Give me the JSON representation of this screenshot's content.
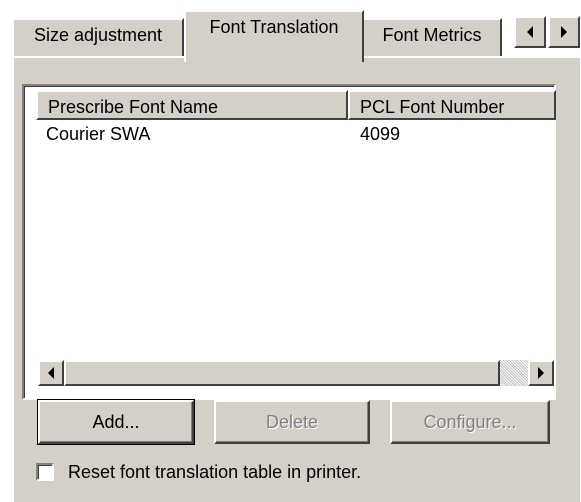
{
  "tabs": [
    {
      "label": "Size adjustment",
      "active": false
    },
    {
      "label": "Font Translation",
      "active": true
    },
    {
      "label": "Font Metrics",
      "active": false
    }
  ],
  "tab_scroll": {
    "left_icon": "arrow-left-icon",
    "right_icon": "arrow-right-icon"
  },
  "list": {
    "columns": [
      "Prescribe Font Name",
      "PCL Font Number"
    ],
    "rows": [
      {
        "name": "Courier SWA",
        "number": "4099"
      }
    ]
  },
  "buttons": {
    "add": "Add...",
    "delete": "Delete",
    "configure": "Configure..."
  },
  "checkbox": {
    "label": "Reset font translation table in printer.",
    "checked": false
  },
  "colors": {
    "face": "#d4d0c8",
    "highlight": "#ffffff",
    "shadow": "#808080",
    "dark_shadow": "#404040",
    "disabled_text": "#808080"
  }
}
